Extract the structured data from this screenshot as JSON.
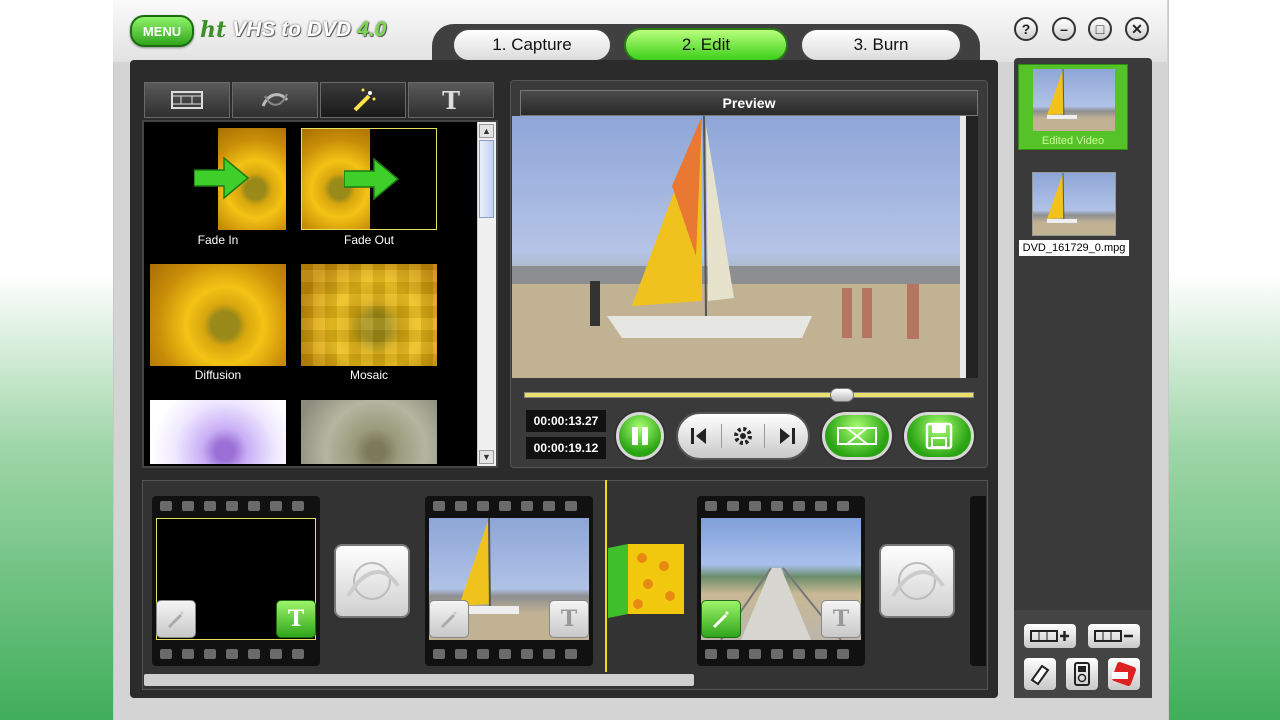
{
  "app": {
    "menu_label": "MENU",
    "logo": {
      "ht": "ht",
      "name": "VHS to DVD",
      "version": "4.0"
    }
  },
  "steps": [
    {
      "label": "1. Capture",
      "active": false
    },
    {
      "label": "2. Edit",
      "active": true
    },
    {
      "label": "3. Burn",
      "active": false
    }
  ],
  "window_buttons": {
    "help": "?",
    "minimize": "–",
    "maximize": "□",
    "close": "✕"
  },
  "effects_tabs": [
    {
      "icon": "film-strip-icon"
    },
    {
      "icon": "transition-icon"
    },
    {
      "icon": "magic-wand-icon",
      "active": true
    },
    {
      "icon": "text-icon",
      "label": "T"
    }
  ],
  "effects": [
    {
      "label": "Fade In",
      "style": "fade-in"
    },
    {
      "label": "Fade Out",
      "style": "fade-out",
      "selected": true
    },
    {
      "label": "Diffusion",
      "style": "diffusion"
    },
    {
      "label": "Mosaic",
      "style": "mosaic"
    }
  ],
  "preview": {
    "title": "Preview",
    "current_time": "00:00:13.27",
    "total_time": "00:00:19.12",
    "position": 0.71
  },
  "controls": {
    "pause": "pause-icon",
    "prev": "step-back-icon",
    "settings": "gear-icon",
    "next": "step-forward-icon",
    "trim": "trim-icon",
    "save": "save-icon"
  },
  "timeline": {
    "clip_text_label": "T"
  },
  "media": {
    "edited_label": "Edited Video",
    "file_label": "DVD_161729_0.mpg"
  },
  "colors": {
    "accent_green": "#3ccf1a",
    "timeline_marker": "#e8e014",
    "selection_yellow": "#e8e05a"
  }
}
